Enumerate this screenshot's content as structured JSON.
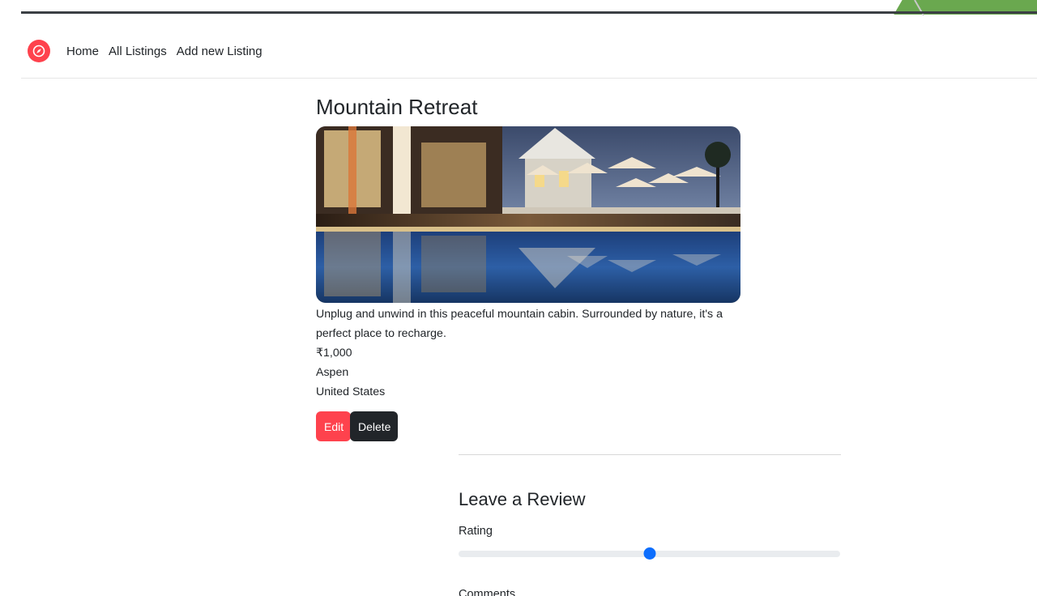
{
  "nav": {
    "brand_icon": "compass-icon",
    "brand_color": "#fe424d",
    "links": [
      "Home",
      "All Listings",
      "Add new Listing"
    ]
  },
  "listing": {
    "title": "Mountain Retreat",
    "image_alt": "resort-pool-photo",
    "description": "Unplug and unwind in this peaceful mountain cabin. Surrounded by nature, it's a perfect place to recharge.",
    "price": "₹1,000",
    "location": "Aspen",
    "country": "United States",
    "edit_label": "Edit",
    "delete_label": "Delete"
  },
  "review": {
    "title": "Leave a Review",
    "rating_label": "Rating",
    "rating_fraction": 0.5,
    "comments_label": "Comments"
  },
  "colors": {
    "accent": "#fe424d",
    "dark": "#212529",
    "range_thumb": "#0d6efd"
  }
}
